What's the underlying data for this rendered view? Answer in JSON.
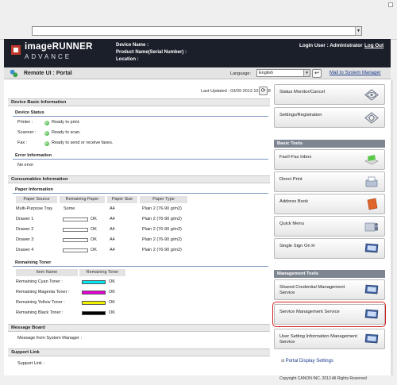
{
  "header": {
    "brand_main": "imageRUNNER",
    "brand_sub": "ADVANCE",
    "device_name_label": "Device Name :",
    "product_name_label": "Product Name(Serial Number) :",
    "location_label": "Location :",
    "login_user": "Login User : Administrator",
    "logout": "Log Out"
  },
  "portal_bar": {
    "title": "Remote UI : Portal",
    "language_label": "Language:",
    "language_value": "English",
    "mail_link": "Mail to System Manager"
  },
  "last_updated": "Last Updated : 03/09 2013 10:21:28",
  "device_basic": {
    "title": "Device Basic Information",
    "status_title": "Device Status",
    "status": [
      {
        "label": "Printer :",
        "value": "Ready to print."
      },
      {
        "label": "Scanner :",
        "value": "Ready to scan."
      },
      {
        "label": "Fax :",
        "value": "Ready to send or receive faxes."
      }
    ],
    "error_title": "Error Information",
    "error_value": "No error"
  },
  "consumables": {
    "title": "Consumables Information",
    "paper_title": "Paper Information",
    "paper_headers": [
      "Paper Source",
      "Remaining Paper",
      "Paper Size",
      "Paper Type"
    ],
    "paper_rows": [
      {
        "source": "Multi-Purpose Tray",
        "remaining": "Some",
        "ok": "",
        "size": "A4",
        "type": "Plain 2 (76-90 g/m2)",
        "has_bar": false
      },
      {
        "source": "Drawer 1",
        "remaining": "",
        "ok": "OK",
        "size": "A4",
        "type": "Plain 2 (76-90 g/m2)",
        "has_bar": true
      },
      {
        "source": "Drawer 2",
        "remaining": "",
        "ok": "OK",
        "size": "A4",
        "type": "Plain 2 (76-90 g/m2)",
        "has_bar": true
      },
      {
        "source": "Drawer 3",
        "remaining": "",
        "ok": "OK",
        "size": "A4",
        "type": "Plain 2 (76-90 g/m2)",
        "has_bar": true
      },
      {
        "source": "Drawer 4",
        "remaining": "",
        "ok": "OK",
        "size": "A4",
        "type": "Plain 2 (76-90 g/m2)",
        "has_bar": true
      }
    ],
    "toner_title": "Remaining Toner",
    "toner_headers": [
      "Item Name",
      "Remaining Toner"
    ],
    "toner_rows": [
      {
        "name": "Remaining Cyan Toner :",
        "ok": "OK",
        "color": "#00e5f0"
      },
      {
        "name": "Remaining Magenta Toner :",
        "ok": "OK",
        "color": "#e800d8"
      },
      {
        "name": "Remaining Yellow Toner :",
        "ok": "OK",
        "color": "#f2f200"
      },
      {
        "name": "Remaining Black Toner :",
        "ok": "OK",
        "color": "#000000"
      }
    ]
  },
  "message_board": {
    "title": "Message Board",
    "label": "Message from System Manager :"
  },
  "support_link": {
    "title": "Support Link",
    "label": "Support Link :"
  },
  "right_panel": {
    "top_buttons": [
      {
        "label": "Status Monitor/Cancel",
        "icon": "eye-icon"
      },
      {
        "label": "Settings/Registration",
        "icon": "gear-icon"
      }
    ],
    "basic_tools_title": "Basic Tools",
    "basic_tools": [
      {
        "label": "Fax/I-Fax Inbox",
        "icon": "fax-inbox-icon"
      },
      {
        "label": "Direct Print",
        "icon": "printer-icon"
      },
      {
        "label": "Address Book",
        "icon": "address-book-icon"
      },
      {
        "label": "Quick Menu",
        "icon": "quick-menu-icon"
      },
      {
        "label": "Single Sign On H",
        "icon": "monitor-icon"
      }
    ],
    "management_tools_title": "Management Tools",
    "management_tools": [
      {
        "label": "Shared Credential Management Service",
        "icon": "monitor-icon"
      },
      {
        "label": "Service Management Service",
        "icon": "monitor-icon"
      },
      {
        "label": "User Setting Information Management Service",
        "icon": "monitor-icon"
      }
    ],
    "portal_display_settings": "Portal Display Settings"
  },
  "copyright": "Copyright CANON INC. 2013 All Rights Reserved",
  "colors": {
    "header_bg": "#1b1f2a",
    "highlight": "#d42020",
    "status_dot": "#2da02d",
    "right_section_header": "#7d8590"
  }
}
